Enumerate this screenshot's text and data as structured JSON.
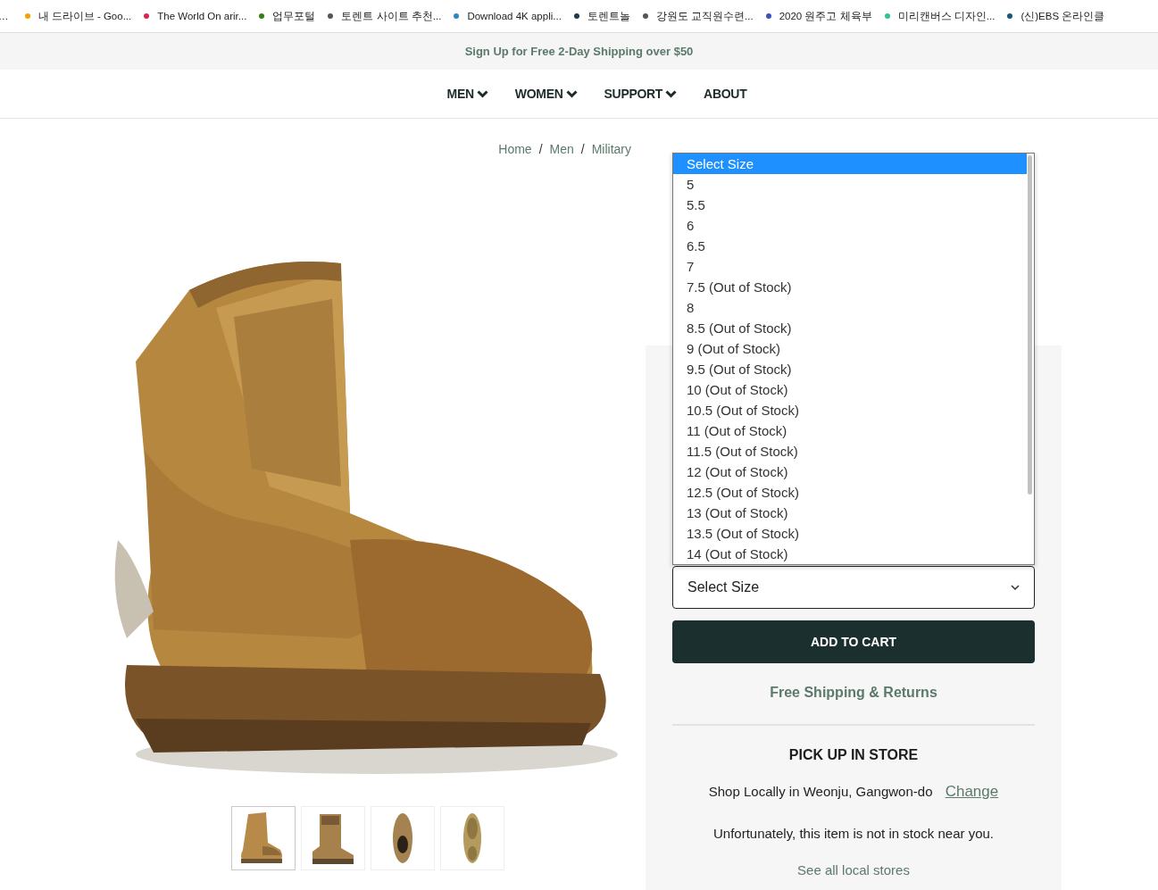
{
  "bookmarks_bar": {
    "leading_fragment": "…",
    "items": [
      {
        "label": "내 드라이브 - Goo...",
        "color": "#f4a100"
      },
      {
        "label": "The World On arir...",
        "color": "#e0234e"
      },
      {
        "label": "업무포털",
        "color": "#3a7d12"
      },
      {
        "label": "토렌트 사이트 추천...",
        "color": "#555555"
      },
      {
        "label": "Download 4K appli...",
        "color": "#2e86c1"
      },
      {
        "label": "토렌트놀",
        "color": "#1f3a4a"
      },
      {
        "label": "강원도 교직원수련...",
        "color": "#555555"
      },
      {
        "label": "2020 원주고 체육부",
        "color": "#3f51b5"
      },
      {
        "label": "미리캔버스 디자인...",
        "color": "#2ec48e"
      },
      {
        "label": "(신)EBS 온라인클",
        "color": "#17577a"
      }
    ]
  },
  "promo_bar": {
    "text": "Sign Up for Free 2-Day Shipping over $50"
  },
  "nav": {
    "items": [
      {
        "label": "MEN",
        "kind": "dropdown"
      },
      {
        "label": "WOMEN",
        "kind": "dropdown"
      },
      {
        "label": "SUPPORT",
        "kind": "dropdown"
      },
      {
        "label": "ABOUT",
        "kind": "link"
      }
    ]
  },
  "breadcrumb": {
    "separator": "/",
    "items": [
      "Home",
      "Men",
      "Military"
    ]
  },
  "gallery": {
    "thumbnails": [
      {
        "kind": "side",
        "selected": true
      },
      {
        "kind": "back",
        "selected": false
      },
      {
        "kind": "top",
        "selected": false
      },
      {
        "kind": "sole",
        "selected": false
      }
    ]
  },
  "size_select": {
    "value": "Select Size",
    "options": [
      {
        "label": "Select Size",
        "selected": true
      },
      {
        "label": "5",
        "selected": false
      },
      {
        "label": "5.5",
        "selected": false
      },
      {
        "label": "6",
        "selected": false
      },
      {
        "label": "6.5",
        "selected": false
      },
      {
        "label": "7",
        "selected": false
      },
      {
        "label": "7.5 (Out of Stock)",
        "selected": false
      },
      {
        "label": "8",
        "selected": false
      },
      {
        "label": "8.5 (Out of Stock)",
        "selected": false
      },
      {
        "label": "9 (Out of Stock)",
        "selected": false
      },
      {
        "label": "9.5 (Out of Stock)",
        "selected": false
      },
      {
        "label": "10 (Out of Stock)",
        "selected": false
      },
      {
        "label": "10.5 (Out of Stock)",
        "selected": false
      },
      {
        "label": "11 (Out of Stock)",
        "selected": false
      },
      {
        "label": "11.5 (Out of Stock)",
        "selected": false
      },
      {
        "label": "12 (Out of Stock)",
        "selected": false
      },
      {
        "label": "12.5 (Out of Stock)",
        "selected": false
      },
      {
        "label": "13 (Out of Stock)",
        "selected": false
      },
      {
        "label": "13.5 (Out of Stock)",
        "selected": false
      },
      {
        "label": "14 (Out of Stock)",
        "selected": false
      }
    ]
  },
  "add_to_cart": "ADD TO CART",
  "shipping_link": "Free Shipping & Returns",
  "pickup": {
    "title": "PICK UP IN STORE",
    "location": "Shop Locally in Weonju, Gangwon-do",
    "change_link": "Change",
    "message": "Unfortunately, this item is not in stock near you.",
    "stores_link": "See all local stores"
  }
}
